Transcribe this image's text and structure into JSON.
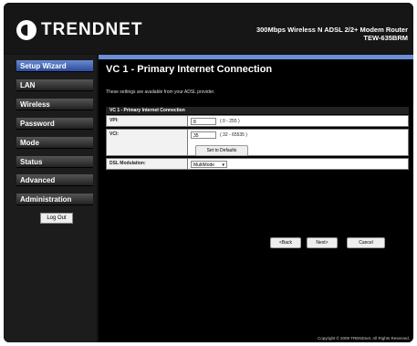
{
  "brand": {
    "logo_text": "TRENDNET",
    "product_line1": "300Mbps Wireless N ADSL 2/2+ Modem Router",
    "product_line2": "TEW-635BRM"
  },
  "sidebar": {
    "items": [
      {
        "label": "Setup Wizard"
      },
      {
        "label": "LAN"
      },
      {
        "label": "Wireless"
      },
      {
        "label": "Password"
      },
      {
        "label": "Mode"
      },
      {
        "label": "Status"
      },
      {
        "label": "Advanced"
      },
      {
        "label": "Administration"
      }
    ],
    "logout_label": "Log Out"
  },
  "main": {
    "title": "VC 1 - Primary Internet Connection",
    "description": "These settings are available from your ADSL provider.",
    "table_header": "VC 1 - Primary Internet Connection",
    "vpi": {
      "label": "VPI:",
      "value": "8",
      "hint": "( 0 - 255 )"
    },
    "vci": {
      "label": "VCI:",
      "value": "35",
      "hint": "( 32 - 65535 )",
      "defaults_button": "Set to Defaults"
    },
    "dsl": {
      "label": "DSL Modulation:",
      "value": "MultiMode"
    }
  },
  "buttons": {
    "back": "<Back",
    "next": "Next>",
    "cancel": "Cancel"
  },
  "footer": {
    "copyright": "Copyright © 2009 TRENDnet. All Rights Reserved."
  },
  "colors": {
    "accent": "#6a8fd8",
    "background": "#000000"
  }
}
